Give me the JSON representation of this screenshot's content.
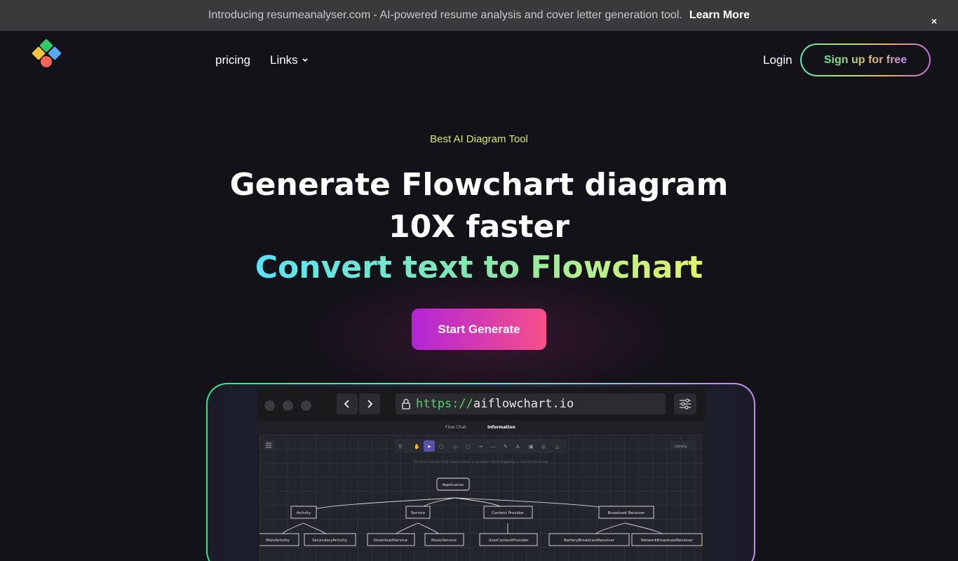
{
  "announcement": {
    "text": "Introducing resumeanalyser.com - AI-powered resume analysis and cover letter generation tool.",
    "link_label": "Learn More",
    "close_label": "×"
  },
  "nav": {
    "items": [
      {
        "label": "pricing"
      },
      {
        "label": "Links"
      }
    ],
    "login_label": "Login",
    "signup_label": "Sign up for free"
  },
  "hero": {
    "kicker": "Best AI Diagram Tool",
    "headline": "Generate Flowchart diagram 10X faster",
    "subheadline": "Convert text to Flowchart",
    "cta_label": "Start Generate"
  },
  "preview": {
    "url_scheme": "https://",
    "url_host": "aiflowchart.io",
    "tabs": [
      "Flow Chat",
      "Information"
    ],
    "library_label": "Library",
    "hint": "To move canvas, hold mouse wheel or spacebar while dragging, or use the hand tool",
    "nodes": {
      "root": "Application",
      "level1": [
        "Activity",
        "Service",
        "Content Provider",
        "Broadcast Receiver"
      ],
      "level2": [
        "MainActivity",
        "SecondaryActivity",
        "DownloadService",
        "MusicService",
        "UserContentProvider",
        "BatteryBroadcastReceiver",
        "NetworkBroadcastReceiver"
      ]
    }
  },
  "colors": {
    "background": "#121218",
    "announce_bar": "#3a3a3c",
    "kicker": "#d9e86a",
    "cta_start": "#b325d6",
    "cta_end": "#f5508a"
  }
}
